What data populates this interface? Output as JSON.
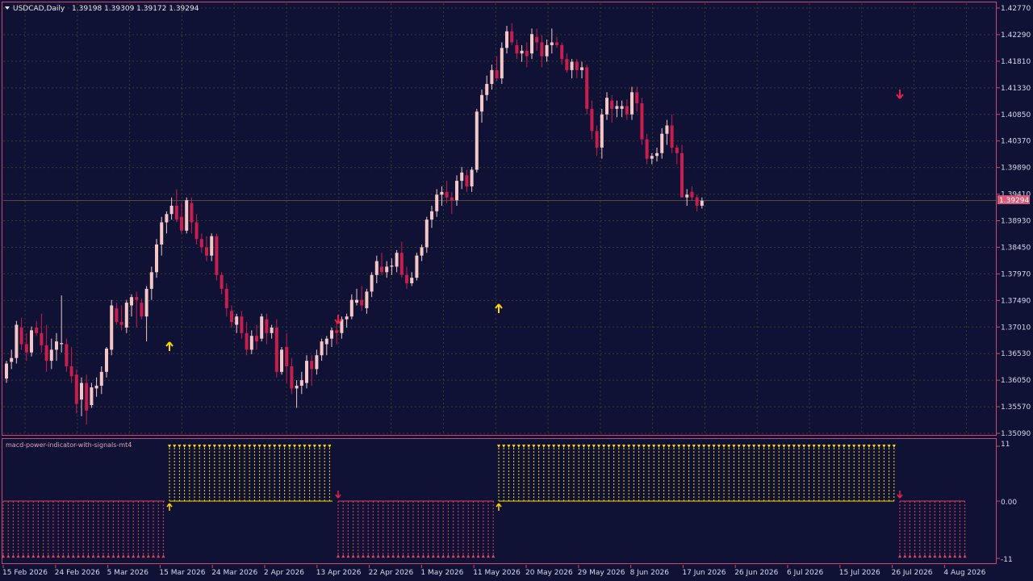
{
  "header": {
    "symbol": "USDCAD,Daily",
    "ohlc": "1.39198 1.39309 1.39172 1.39294"
  },
  "indicator": {
    "name": "macd-power-indicator-with-signals-mt4",
    "levels": [
      "11",
      "0.00",
      "-11"
    ]
  },
  "price_axis": {
    "labels": [
      "1.42770",
      "1.42290",
      "1.41810",
      "1.41330",
      "1.40850",
      "1.40370",
      "1.39890",
      "1.39410",
      "1.38930",
      "1.38450",
      "1.37970",
      "1.37490",
      "1.37010",
      "1.36530",
      "1.36050",
      "1.35570",
      "1.35090"
    ],
    "current_price": "1.39294"
  },
  "time_axis": {
    "labels": [
      "15 Feb 2026",
      "24 Feb 2026",
      "5 Mar 2026",
      "15 Mar 2026",
      "24 Mar 2026",
      "2 Apr 2026",
      "13 Apr 2026",
      "22 Apr 2026",
      "1 May 2026",
      "11 May 2026",
      "20 May 2026",
      "29 May 2026",
      "8 Jun 2026",
      "17 Jun 2026",
      "26 Jun 2026",
      "6 Jul 2026",
      "15 Jul 2026",
      "26 Jul 2026",
      "4 Aug 2026"
    ]
  },
  "colors": {
    "background": "#101235",
    "bull": "#f4c6c6",
    "bear": "#c81e4e",
    "grid": "#3c3c2e",
    "frame": "#c84a6e",
    "buy_signal": "#ffd700",
    "sell_signal": "#e8204a",
    "neg_hist": "#e8405c",
    "price_tag": "#d85a7a"
  },
  "signals": [
    {
      "type": "buy",
      "date": "15 Mar 2026"
    },
    {
      "type": "sell",
      "date": "13 Apr 2026"
    },
    {
      "type": "buy",
      "date": "11 May 2026"
    },
    {
      "type": "sell",
      "date": "26 Jul 2026"
    }
  ],
  "chart_data": {
    "type": "candlestick",
    "symbol": "USDCAD",
    "timeframe": "Daily",
    "ylim": [
      1.3509,
      1.4277
    ],
    "candles": [
      [
        1.3608,
        1.364,
        1.36,
        1.3635
      ],
      [
        1.3638,
        1.366,
        1.3625,
        1.3645
      ],
      [
        1.3645,
        1.3712,
        1.3635,
        1.3705
      ],
      [
        1.37,
        1.3718,
        1.366,
        1.367
      ],
      [
        1.367,
        1.369,
        1.364,
        1.3655
      ],
      [
        1.3655,
        1.3702,
        1.3648,
        1.3695
      ],
      [
        1.37,
        1.3712,
        1.3685,
        1.369
      ],
      [
        1.369,
        1.3725,
        1.3655,
        1.3668
      ],
      [
        1.3668,
        1.3705,
        1.362,
        1.364
      ],
      [
        1.364,
        1.368,
        1.3625,
        1.366
      ],
      [
        1.366,
        1.369,
        1.364,
        1.3675
      ],
      [
        1.367,
        1.3758,
        1.3655,
        1.3672
      ],
      [
        1.367,
        1.368,
        1.362,
        1.363
      ],
      [
        1.363,
        1.3665,
        1.36,
        1.3612
      ],
      [
        1.3615,
        1.3625,
        1.3545,
        1.3562
      ],
      [
        1.357,
        1.361,
        1.354,
        1.36
      ],
      [
        1.36,
        1.3615,
        1.3525,
        1.355
      ],
      [
        1.356,
        1.36,
        1.3555,
        1.3592
      ],
      [
        1.359,
        1.361,
        1.3575,
        1.3595
      ],
      [
        1.3595,
        1.363,
        1.358,
        1.362
      ],
      [
        1.362,
        1.3665,
        1.361,
        1.3662
      ],
      [
        1.366,
        1.375,
        1.365,
        1.374
      ],
      [
        1.3735,
        1.3745,
        1.3705,
        1.371
      ],
      [
        1.371,
        1.374,
        1.3695,
        1.3705
      ],
      [
        1.37,
        1.375,
        1.369,
        1.3745
      ],
      [
        1.374,
        1.376,
        1.372,
        1.3755
      ],
      [
        1.3755,
        1.3765,
        1.37,
        1.375
      ],
      [
        1.3745,
        1.3752,
        1.3715,
        1.372
      ],
      [
        1.372,
        1.3775,
        1.3675,
        1.377
      ],
      [
        1.377,
        1.381,
        1.375,
        1.38
      ],
      [
        1.38,
        1.386,
        1.379,
        1.385
      ],
      [
        1.385,
        1.39,
        1.383,
        1.389
      ],
      [
        1.389,
        1.391,
        1.387,
        1.3905
      ],
      [
        1.3905,
        1.3935,
        1.3895,
        1.392
      ],
      [
        1.392,
        1.395,
        1.389,
        1.3895
      ],
      [
        1.39,
        1.3925,
        1.387,
        1.3875
      ],
      [
        1.3875,
        1.3935,
        1.387,
        1.393
      ],
      [
        1.3925,
        1.3935,
        1.387,
        1.389
      ],
      [
        1.389,
        1.3905,
        1.385,
        1.386
      ],
      [
        1.386,
        1.387,
        1.3835,
        1.3845
      ],
      [
        1.3845,
        1.3865,
        1.382,
        1.383
      ],
      [
        1.383,
        1.387,
        1.382,
        1.3865
      ],
      [
        1.3865,
        1.387,
        1.3785,
        1.3795
      ],
      [
        1.3795,
        1.38,
        1.376,
        1.377
      ],
      [
        1.377,
        1.378,
        1.372,
        1.3735
      ],
      [
        1.373,
        1.374,
        1.37,
        1.371
      ],
      [
        1.3705,
        1.3725,
        1.369,
        1.372
      ],
      [
        1.372,
        1.373,
        1.368,
        1.369
      ],
      [
        1.369,
        1.371,
        1.365,
        1.366
      ],
      [
        1.366,
        1.3695,
        1.3652,
        1.3685
      ],
      [
        1.3685,
        1.3705,
        1.366,
        1.3675
      ],
      [
        1.368,
        1.3725,
        1.3675,
        1.372
      ],
      [
        1.3715,
        1.3725,
        1.367,
        1.369
      ],
      [
        1.369,
        1.3705,
        1.368,
        1.37
      ],
      [
        1.37,
        1.3715,
        1.361,
        1.362
      ],
      [
        1.362,
        1.3665,
        1.3615,
        1.366
      ],
      [
        1.3665,
        1.369,
        1.36,
        1.363
      ],
      [
        1.363,
        1.3645,
        1.358,
        1.359
      ],
      [
        1.359,
        1.3605,
        1.3555,
        1.3595
      ],
      [
        1.3595,
        1.362,
        1.358,
        1.3605
      ],
      [
        1.36,
        1.365,
        1.359,
        1.364
      ],
      [
        1.364,
        1.365,
        1.3595,
        1.3625
      ],
      [
        1.3625,
        1.366,
        1.3615,
        1.365
      ],
      [
        1.365,
        1.368,
        1.364,
        1.3675
      ],
      [
        1.367,
        1.3685,
        1.365,
        1.368
      ],
      [
        1.368,
        1.37,
        1.3665,
        1.3695
      ],
      [
        1.3695,
        1.371,
        1.367,
        1.369
      ],
      [
        1.369,
        1.372,
        1.368,
        1.3715
      ],
      [
        1.3715,
        1.3725,
        1.37,
        1.372
      ],
      [
        1.372,
        1.376,
        1.3715,
        1.375
      ],
      [
        1.3745,
        1.377,
        1.374,
        1.375
      ],
      [
        1.375,
        1.3775,
        1.373,
        1.374
      ],
      [
        1.3735,
        1.377,
        1.3725,
        1.3765
      ],
      [
        1.3765,
        1.38,
        1.3755,
        1.3795
      ],
      [
        1.3795,
        1.383,
        1.378,
        1.382
      ],
      [
        1.381,
        1.3835,
        1.3795,
        1.38
      ],
      [
        1.38,
        1.382,
        1.379,
        1.381
      ],
      [
        1.381,
        1.3825,
        1.3795,
        1.3812
      ],
      [
        1.381,
        1.384,
        1.38,
        1.3835
      ],
      [
        1.3835,
        1.3855,
        1.379,
        1.3795
      ],
      [
        1.3795,
        1.381,
        1.377,
        1.378
      ],
      [
        1.378,
        1.38,
        1.3775,
        1.379
      ],
      [
        1.379,
        1.3835,
        1.3785,
        1.383
      ],
      [
        1.383,
        1.385,
        1.382,
        1.3845
      ],
      [
        1.3845,
        1.39,
        1.3835,
        1.3895
      ],
      [
        1.3895,
        1.392,
        1.388,
        1.391
      ],
      [
        1.391,
        1.395,
        1.39,
        1.394
      ],
      [
        1.394,
        1.3955,
        1.392,
        1.3945
      ],
      [
        1.3945,
        1.3965,
        1.3925,
        1.3935
      ],
      [
        1.3935,
        1.3945,
        1.3905,
        1.393
      ],
      [
        1.393,
        1.3975,
        1.392,
        1.3965
      ],
      [
        1.3965,
        1.399,
        1.395,
        1.398
      ],
      [
        1.3975,
        1.3985,
        1.3945,
        1.3955
      ],
      [
        1.3955,
        1.399,
        1.3945,
        1.3985
      ],
      [
        1.3985,
        1.4095,
        1.398,
        1.409
      ],
      [
        1.409,
        1.413,
        1.407,
        1.412
      ],
      [
        1.412,
        1.4155,
        1.411,
        1.414
      ],
      [
        1.414,
        1.4175,
        1.413,
        1.4165
      ],
      [
        1.4165,
        1.419,
        1.4145,
        1.415
      ],
      [
        1.415,
        1.4215,
        1.414,
        1.4205
      ],
      [
        1.4205,
        1.4245,
        1.4195,
        1.4235
      ],
      [
        1.4235,
        1.425,
        1.421,
        1.4215
      ],
      [
        1.421,
        1.422,
        1.4185,
        1.4195
      ],
      [
        1.4195,
        1.421,
        1.418,
        1.42
      ],
      [
        1.42,
        1.4215,
        1.417,
        1.419
      ],
      [
        1.4195,
        1.424,
        1.4185,
        1.423
      ],
      [
        1.4225,
        1.424,
        1.42,
        1.4215
      ],
      [
        1.4215,
        1.4228,
        1.417,
        1.419
      ],
      [
        1.419,
        1.422,
        1.418,
        1.421
      ],
      [
        1.421,
        1.424,
        1.4195,
        1.4215
      ],
      [
        1.4215,
        1.4225,
        1.4205,
        1.421
      ],
      [
        1.421,
        1.4215,
        1.4175,
        1.4185
      ],
      [
        1.4185,
        1.4195,
        1.416,
        1.4165
      ],
      [
        1.4165,
        1.4185,
        1.415,
        1.418
      ],
      [
        1.418,
        1.4185,
        1.415,
        1.4165
      ],
      [
        1.4165,
        1.418,
        1.415,
        1.417
      ],
      [
        1.417,
        1.4175,
        1.4085,
        1.4095
      ],
      [
        1.4095,
        1.411,
        1.404,
        1.4055
      ],
      [
        1.4055,
        1.4065,
        1.401,
        1.4025
      ],
      [
        1.4025,
        1.4095,
        1.4005,
        1.4085
      ],
      [
        1.4085,
        1.4125,
        1.4075,
        1.4115
      ],
      [
        1.411,
        1.412,
        1.407,
        1.4095
      ],
      [
        1.4095,
        1.411,
        1.408,
        1.41
      ],
      [
        1.4095,
        1.411,
        1.408,
        1.41
      ],
      [
        1.41,
        1.4112,
        1.4075,
        1.4085
      ],
      [
        1.4085,
        1.4135,
        1.4075,
        1.4125
      ],
      [
        1.4125,
        1.4135,
        1.409,
        1.4105
      ],
      [
        1.4105,
        1.4115,
        1.403,
        1.404
      ],
      [
        1.404,
        1.405,
        1.3995,
        1.4005
      ],
      [
        1.4005,
        1.4015,
        1.3995,
        1.401
      ],
      [
        1.401,
        1.4025,
        1.4,
        1.4015
      ],
      [
        1.4015,
        1.406,
        1.4005,
        1.405
      ],
      [
        1.405,
        1.4075,
        1.403,
        1.4065
      ],
      [
        1.4065,
        1.4085,
        1.4015,
        1.4025
      ],
      [
        1.4025,
        1.403,
        1.3995,
        1.4015
      ],
      [
        1.4015,
        1.403,
        1.398,
        1.3935
      ],
      [
        1.3935,
        1.395,
        1.392,
        1.394
      ],
      [
        1.3945,
        1.3955,
        1.393,
        1.3935
      ],
      [
        1.3935,
        1.394,
        1.391,
        1.392
      ],
      [
        1.392,
        1.3935,
        1.3915,
        1.3929
      ]
    ]
  }
}
